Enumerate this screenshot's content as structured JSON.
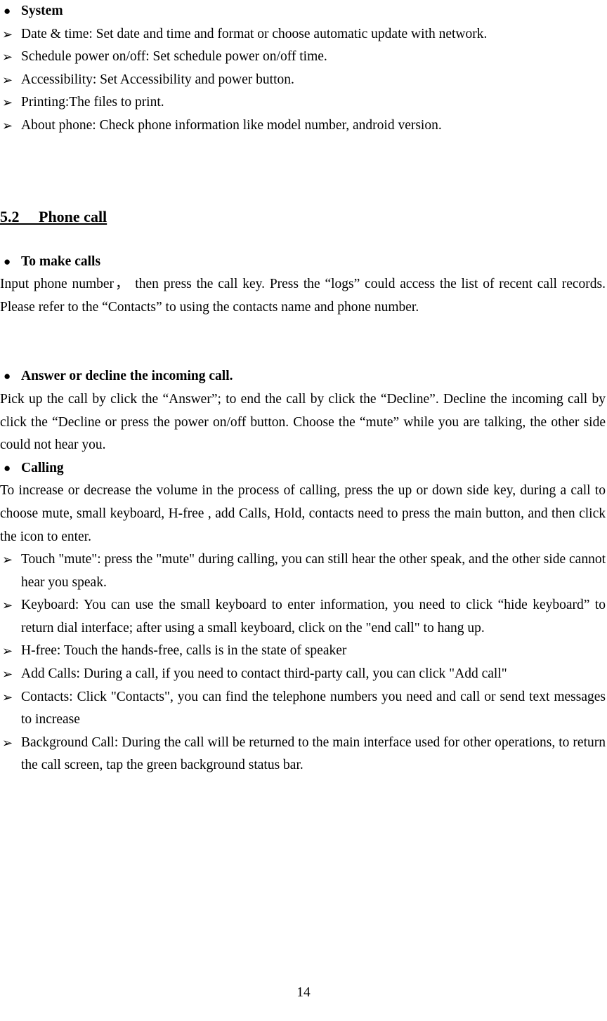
{
  "document": {
    "page_number": "14",
    "bullet_glyphs": {
      "disc": "●",
      "arrow": "➢"
    }
  },
  "section_system": {
    "heading": "System",
    "items": [
      "Date & time: Set date and time and format or choose automatic update with network.",
      "Schedule power on/off: Set schedule power on/off time.",
      "Accessibility: Set Accessibility and power button.",
      "Printing:The files to print.",
      "About phone: Check phone information like model number, android version."
    ]
  },
  "section_phone_call": {
    "number": "5.2",
    "title": "Phone call",
    "heading_full": "5.2  Phone call"
  },
  "subsection_make_calls": {
    "heading": "To make calls",
    "body": "Input phone number， then press the call key. Press the “logs” could access the list of recent call records. Please refer to the “Contacts” to using the contacts name and phone number."
  },
  "subsection_answer_decline": {
    "heading": "Answer or decline the incoming call.",
    "body": "Pick up the call by click the “Answer”; to end the call by click the “Decline”. Decline the incoming call by click the “Decline or press the power on/off button. Choose the “mute” while you are talking, the other side could not hear you."
  },
  "subsection_calling": {
    "heading": "Calling",
    "body": "To increase or decrease the volume in the process of calling, press the up or down side key, during a call to choose mute, small keyboard, H-free , add Calls, Hold, contacts need to press the main button, and then click the icon to enter.",
    "items": [
      "Touch \"mute\": press the \"mute\" during calling, you can still hear the other speak, and the other side cannot hear you speak.",
      "Keyboard: You can use the small keyboard to enter information, you need to click “hide keyboard” to return dial interface; after using a small keyboard, click on the \"end call\" to hang up.",
      "H-free: Touch the hands-free, calls is in the state of speaker",
      "Add Calls: During a call, if you need to contact third-party call, you can click \"Add call\"",
      "Contacts: Click \"Contacts\", you can find the telephone numbers you need and call or send text messages to increase",
      "Background Call: During the call will be returned to the main interface used for other operations, to return the call screen, tap the green background status bar."
    ]
  }
}
